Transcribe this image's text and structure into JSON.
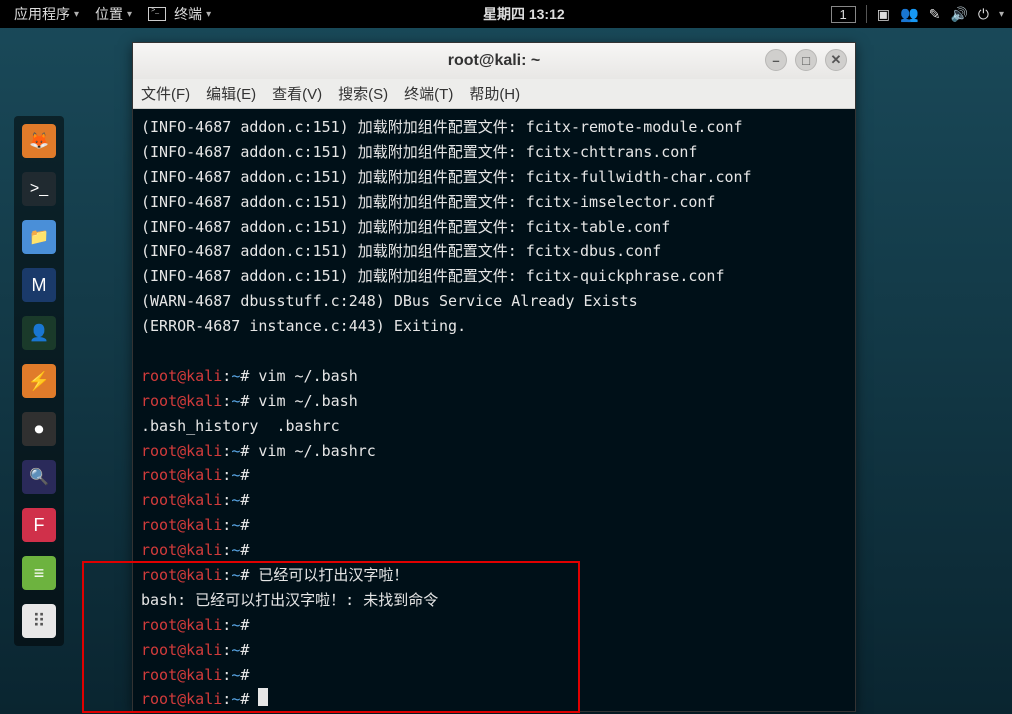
{
  "topbar": {
    "apps": "应用程序",
    "places": "位置",
    "terminal": "终端",
    "clock": "星期四 13:12",
    "workspace": "1"
  },
  "dock": [
    {
      "name": "firefox-icon",
      "bg": "#e07b2a",
      "glyph": "🦊"
    },
    {
      "name": "terminal-icon",
      "bg": "#202a30",
      "glyph": ">_"
    },
    {
      "name": "files-icon",
      "bg": "#4a8fd8",
      "glyph": "📁"
    },
    {
      "name": "metasploit-icon",
      "bg": "#1a3a6a",
      "glyph": "M"
    },
    {
      "name": "armitage-icon",
      "bg": "#1a3a2a",
      "glyph": "👤"
    },
    {
      "name": "burp-icon",
      "bg": "#e07b2a",
      "glyph": "⚡"
    },
    {
      "name": "recorder-icon",
      "bg": "#303030",
      "glyph": "⏺"
    },
    {
      "name": "zenmap-icon",
      "bg": "#2a2a5a",
      "glyph": "🔍"
    },
    {
      "name": "faraday-icon",
      "bg": "#d0304a",
      "glyph": "F"
    },
    {
      "name": "notes-icon",
      "bg": "#6db33f",
      "glyph": "≡"
    },
    {
      "name": "apps-icon",
      "bg": "#e8e8e8",
      "glyph": "⠿"
    }
  ],
  "window": {
    "title": "root@kali: ~",
    "menu": [
      "文件(F)",
      "编辑(E)",
      "查看(V)",
      "搜索(S)",
      "终端(T)",
      "帮助(H)"
    ]
  },
  "log_prefix": "(INFO-4687 addon.c:151) 加载附加组件配置文件: ",
  "log_files": [
    "fcitx-remote-module.conf",
    "fcitx-chttrans.conf",
    "fcitx-fullwidth-char.conf",
    "fcitx-imselector.conf",
    "fcitx-table.conf",
    "fcitx-dbus.conf",
    "fcitx-quickphrase.conf"
  ],
  "warn_line": "(WARN-4687 dbusstuff.c:248) DBus Service Already Exists",
  "error_line": "(ERROR-4687 instance.c:443) Exiting.",
  "prompt": {
    "user": "root@kali",
    "sep1": ":",
    "path": "~",
    "hash": "#"
  },
  "cmds": {
    "vim_bash": " vim ~/.bash",
    "bash_complete": ".bash_history  .bashrc",
    "vim_bashrc": " vim ~/.bashrc",
    "cn_input": " 已经可以打出汉字啦！",
    "bash_err": "bash: 已经可以打出汉字啦！: 未找到命令"
  }
}
